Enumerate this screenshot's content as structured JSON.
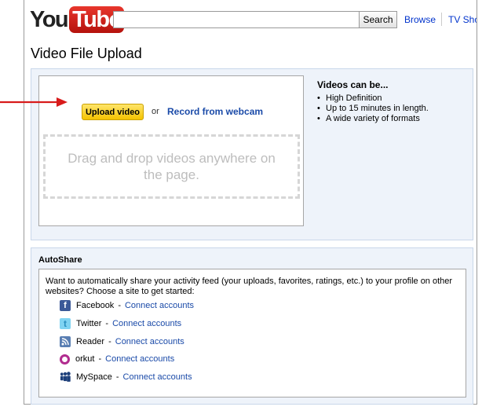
{
  "header": {
    "logo_you": "You",
    "logo_tube": "Tube",
    "search_value": "",
    "search_label": "Search",
    "nav_browse": "Browse",
    "nav_tv": "TV Shows"
  },
  "page_title": "Video File Upload",
  "upload": {
    "button_label": "Upload video",
    "or_text": "or",
    "webcam_link": "Record from webcam",
    "drop_text": "Drag and drop videos anywhere on the page."
  },
  "info": {
    "title": "Videos can be...",
    "items": [
      "High Definition",
      "Up to 15 minutes in length.",
      "A wide variety of formats"
    ]
  },
  "autoshare": {
    "title": "AutoShare",
    "description": "Want to automatically share your activity feed (your uploads, favorites, ratings, etc.) to your profile on other websites? Choose a site to get started:",
    "services": [
      {
        "name": "Facebook",
        "link": "Connect accounts",
        "icon": "facebook-icon"
      },
      {
        "name": "Twitter",
        "link": "Connect accounts",
        "icon": "twitter-icon"
      },
      {
        "name": "Reader",
        "link": "Connect accounts",
        "icon": "reader-icon"
      },
      {
        "name": "orkut",
        "link": "Connect accounts",
        "icon": "orkut-icon"
      },
      {
        "name": "MySpace",
        "link": "Connect accounts",
        "icon": "myspace-icon"
      }
    ],
    "separator": "-"
  },
  "colors": {
    "link": "#1a4aa8",
    "upload_button": "#f4c300",
    "panel_bg": "#eef3fa",
    "arrow": "#d81b1b"
  }
}
